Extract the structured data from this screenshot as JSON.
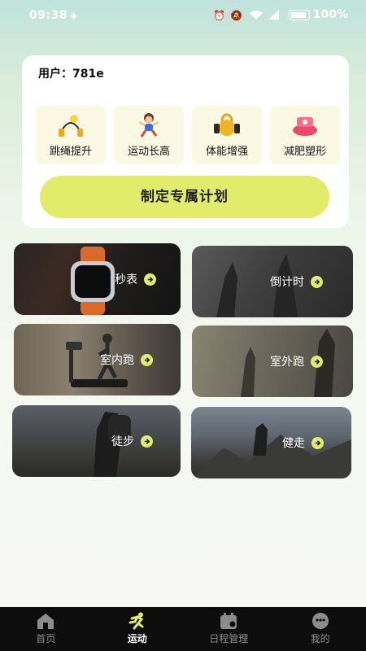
{
  "status": {
    "time": "09:38",
    "battery": "100%"
  },
  "user": {
    "label": "用户：781e"
  },
  "goals": [
    {
      "label": "跳绳提升",
      "icon": "jump-rope-icon"
    },
    {
      "label": "运动长高",
      "icon": "running-kid-icon"
    },
    {
      "label": "体能增强",
      "icon": "kettlebell-icon"
    },
    {
      "label": "减肥塑形",
      "icon": "scale-icon"
    }
  ],
  "plan_button": "制定专属计划",
  "tiles": [
    {
      "label": "秒表"
    },
    {
      "label": "倒计时"
    },
    {
      "label": "室内跑"
    },
    {
      "label": "室外跑"
    },
    {
      "label": "徒步"
    },
    {
      "label": "健走"
    }
  ],
  "nav": [
    {
      "label": "首页",
      "icon": "home-icon"
    },
    {
      "label": "运动",
      "icon": "running-icon"
    },
    {
      "label": "日程管理",
      "icon": "calendar-icon"
    },
    {
      "label": "我的",
      "icon": "profile-icon"
    }
  ],
  "colors": {
    "accent": "#e2ec6b",
    "nav_bg": "#0d0d0d"
  }
}
